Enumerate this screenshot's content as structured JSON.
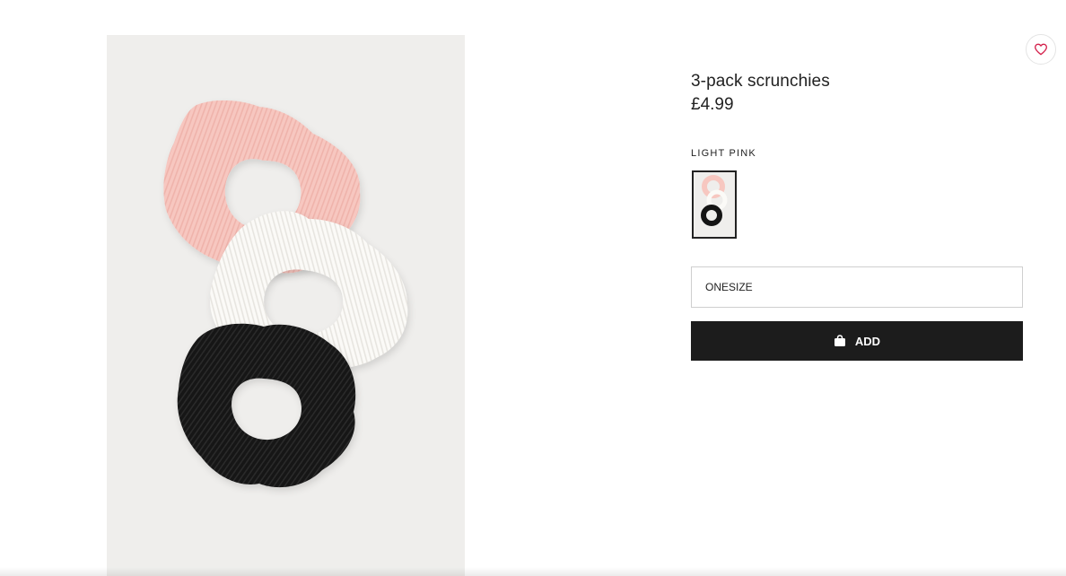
{
  "product": {
    "name": "3-pack scrunchies",
    "price": "£4.99",
    "image_alt_icon": "product-photo",
    "colors": {
      "white": "#ffffff",
      "pink": "#f7c7c0",
      "ivory": "#fbfaf7",
      "black": "#141414",
      "image_bg": "#efeeec"
    }
  },
  "favorite": {
    "icon": "heart-icon",
    "color": "#d4204b"
  },
  "color_selector": {
    "label": "LIGHT PINK",
    "selected_swatch_icon": "scrunchie-swatch"
  },
  "size_selector": {
    "value": "ONESIZE"
  },
  "add_button": {
    "label": "ADD",
    "icon": "shopping-bag-icon",
    "background": "#1c1c1c"
  }
}
